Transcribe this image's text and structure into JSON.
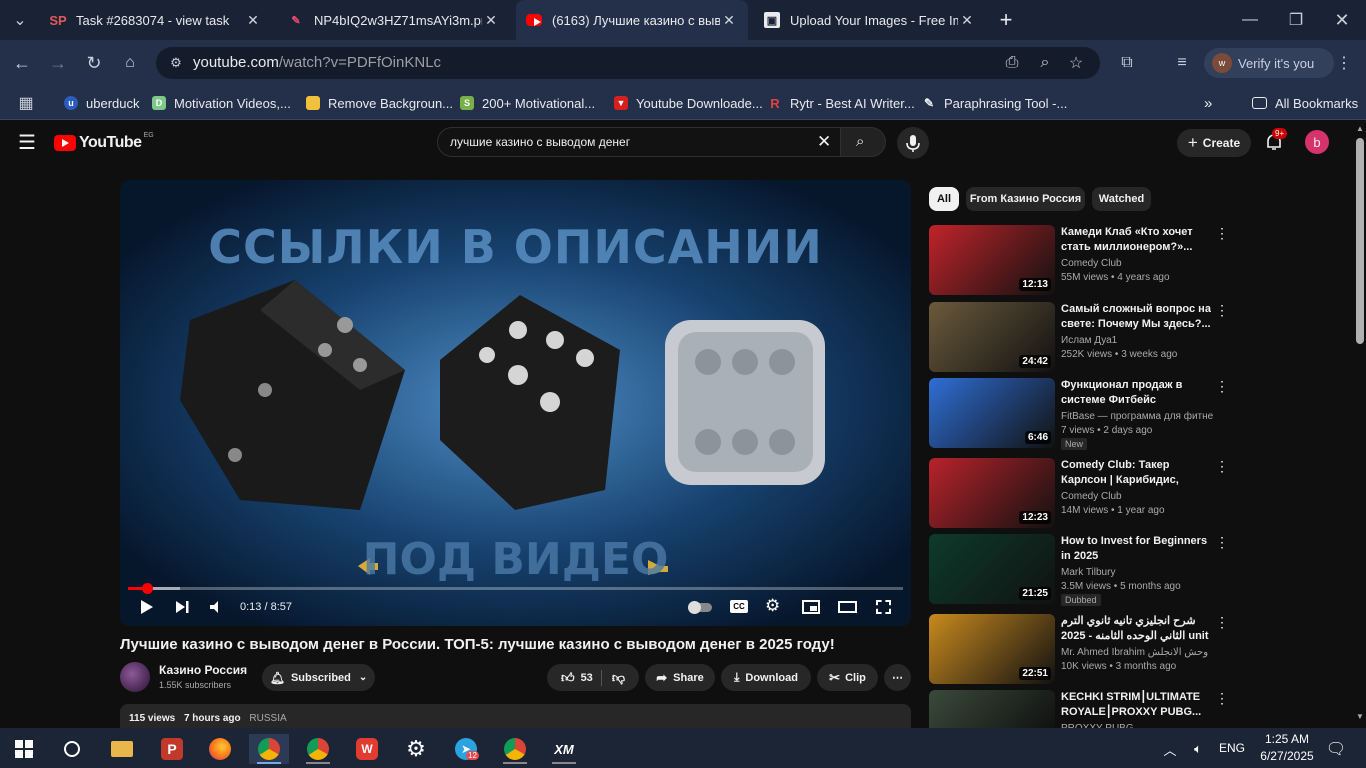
{
  "browser": {
    "tabs": [
      {
        "title": "Task #2683074 - view task",
        "favicon": "SP"
      },
      {
        "title": "NP4bIQ2w3HZ71msAYi3m.png",
        "favicon": "pen"
      },
      {
        "title": "(6163) Лучшие казино с вывод",
        "favicon": "yt"
      },
      {
        "title": "Upload Your Images - Free Imag",
        "favicon": "img"
      }
    ],
    "url_host": "youtube.com",
    "url_path": "/watch?v=PDFfOinKNLc",
    "verify_label": "Verify it's you",
    "bookmarks": [
      "uberduck",
      "Motivation Videos,...",
      "Remove Backgroun...",
      "200+ Motivational...",
      "Youtube Downloade...",
      "Rytr - Best AI Writer...",
      "Paraphrasing Tool -..."
    ],
    "all_bookmarks": "All Bookmarks"
  },
  "youtube": {
    "logo_text": "YouTube",
    "region": "EG",
    "search_query": "лучшие казино с выводом денег",
    "create_label": "Create",
    "notif_count": "9+",
    "avatar_letter": "b",
    "video": {
      "overlay_top": "ССЫЛКИ В ОПИСАНИИ",
      "overlay_bottom": "ПОД ВИДЕО",
      "time": "0:13 / 8:57",
      "progress": 0.024,
      "title": "Лучшие казино с выводом денег в России. ТОП-5: лучшие казино с выводом денег в 2025 году!",
      "channel": "Казино Россия",
      "subscribers": "1.55K subscribers",
      "subscribed_label": "Subscribed",
      "likes": "53",
      "share": "Share",
      "download": "Download",
      "clip": "Clip",
      "views": "115 views",
      "age": "7 hours ago",
      "tag": "RUSSIA"
    },
    "chips": [
      "All",
      "From Казино Россия",
      "Watched"
    ],
    "recommendations": [
      {
        "title": "Камеди Клаб «Кто хочет стать миллионером?»...",
        "channel": "Comedy Club",
        "meta": "55M views • 4 years ago",
        "duration": "12:13",
        "badge": "",
        "color": "#c0242a"
      },
      {
        "title": "Самый сложный вопрос на свете: Почему Мы здесь?...",
        "channel": "Ислам Дуа1",
        "meta": "252K views • 3 weeks ago",
        "duration": "24:42",
        "badge": "",
        "color": "#6b5a3c"
      },
      {
        "title": "Функционал продаж в системе Фитбейс",
        "channel": "FitBase — программа для фитнес-...",
        "meta": "7 views • 2 days ago",
        "duration": "6:46",
        "badge": "New",
        "color": "#2f6fd6"
      },
      {
        "title": "Comedy Club: Такер Карлсон | Карибидис, Батрутдинов,...",
        "channel": "Comedy Club",
        "meta": "14M views • 1 year ago",
        "duration": "12:23",
        "badge": "",
        "color": "#b8232a"
      },
      {
        "title": "How to Invest for Beginners in 2025",
        "channel": "Mark Tilbury",
        "meta": "3.5M views • 5 months ago",
        "duration": "21:25",
        "badge": "Dubbed",
        "color": "#0d3b2b"
      },
      {
        "title": "شرح انجليزي تانيه ثانوي الترم الثاني الوحده الثامنه - 2025 unit 8 - شرح...",
        "channel": "Mr. Ahmed Ibrahim وحش الانجلش",
        "meta": "10K views • 3 months ago",
        "duration": "22:51",
        "badge": "",
        "color": "#c98a1e"
      },
      {
        "title": "KECHKI STRIM⎮ULTIMATE ROYALE⎮PROXXY PUBG...",
        "channel": "PROXXY PUBG",
        "meta": "",
        "duration": "",
        "badge": "",
        "color": "#3a4a3a"
      }
    ]
  },
  "taskbar": {
    "time": "1:25 AM",
    "date": "6/27/2025",
    "lang": "ENG",
    "telegram_badge": "12"
  },
  "colors": {
    "accent_red": "#ff0000",
    "chrome_bg": "#24304a"
  }
}
